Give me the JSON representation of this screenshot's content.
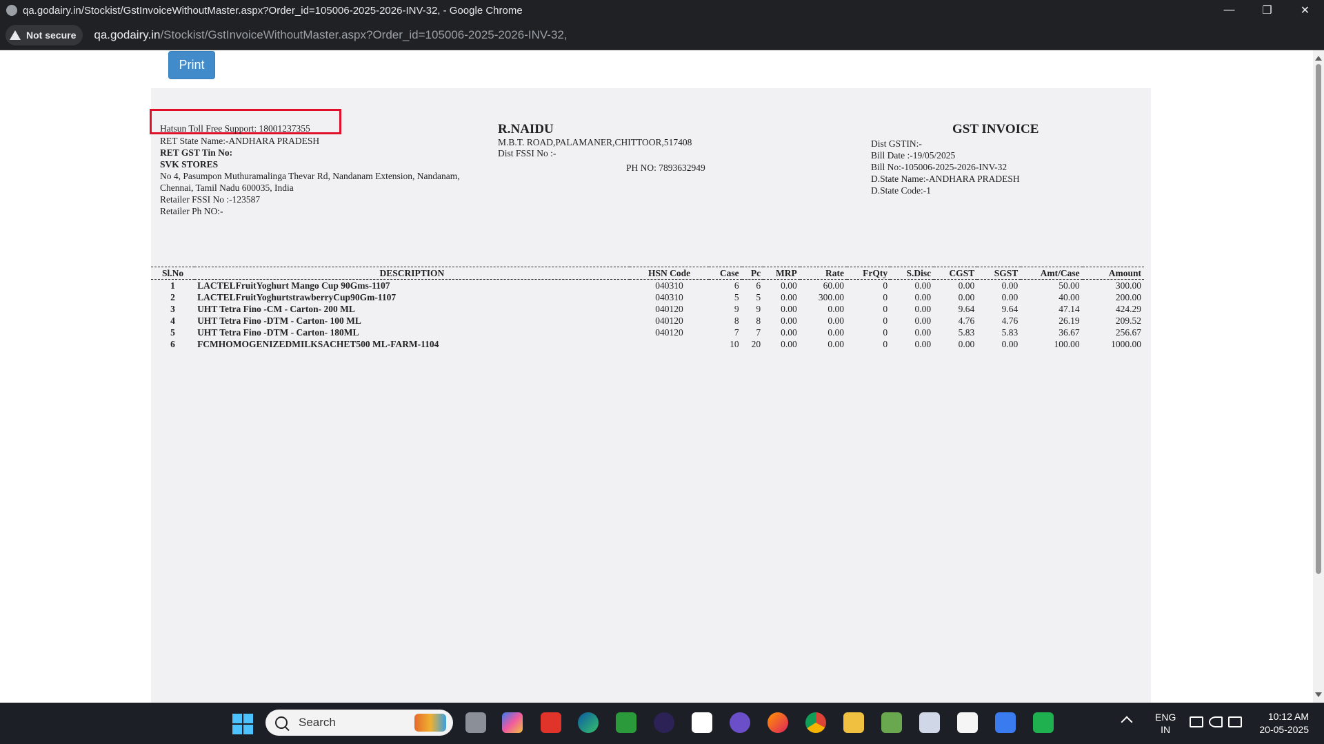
{
  "browser": {
    "window_title": "qa.godairy.in/Stockist/GstInvoiceWithoutMaster.aspx?Order_id=105006-2025-2026-INV-32, - Google Chrome",
    "security_label": "Not secure",
    "url_host": "qa.godairy.in",
    "url_path": "/Stockist/GstInvoiceWithoutMaster.aspx?Order_id=105006-2025-2026-INV-32,"
  },
  "page": {
    "print_label": "Print"
  },
  "invoice": {
    "support": "Hatsun Toll Free Support: 18001237355",
    "ret_state": "RET State Name:-ANDHARA PRADESH",
    "ret_gst": "RET GST Tin No:",
    "retailer_name": "SVK STORES",
    "address_line1": "No 4, Pasumpon Muthuramalinga Thevar Rd, Nandanam Extension, Nandanam,",
    "address_line2": "Chennai, Tamil Nadu 600035, India",
    "retailer_fssi": "Retailer FSSI No :-123587",
    "retailer_ph": "Retailer Ph NO:-",
    "seller_name": "R.NAIDU",
    "seller_address": "M.B.T. ROAD,PALAMANER,CHITTOOR,517408",
    "dist_fssi": "Dist FSSI No :-",
    "ph_no": "PH NO:  7893632949",
    "title": "GST INVOICE",
    "dist_gstin": "Dist GSTIN:-",
    "bill_date": "Bill Date :-19/05/2025",
    "bill_no": "Bill No:-105006-2025-2026-INV-32",
    "d_state_name": "D.State Name:-ANDHARA PRADESH",
    "d_state_code": "D.State Code:-1",
    "columns": [
      "Sl.No",
      "DESCRIPTION",
      "HSN Code",
      "Case",
      "Pc",
      "MRP",
      "Rate",
      "FrQty",
      "S.Disc",
      "CGST",
      "SGST",
      "Amt/Case",
      "Amount"
    ],
    "rows": [
      [
        "1",
        "LACTELFruitYoghurt Mango Cup 90Gms-1107",
        "040310",
        "6",
        "6",
        "0.00",
        "60.00",
        "0",
        "0.00",
        "0.00",
        "0.00",
        "50.00",
        "300.00"
      ],
      [
        "2",
        "LACTELFruitYoghurtstrawberryCup90Gm-1107",
        "040310",
        "5",
        "5",
        "0.00",
        "300.00",
        "0",
        "0.00",
        "0.00",
        "0.00",
        "40.00",
        "200.00"
      ],
      [
        "3",
        "UHT Tetra Fino -CM - Carton- 200 ML",
        "040120",
        "9",
        "9",
        "0.00",
        "0.00",
        "0",
        "0.00",
        "9.64",
        "9.64",
        "47.14",
        "424.29"
      ],
      [
        "4",
        "UHT Tetra Fino -DTM - Carton- 100 ML",
        "040120",
        "8",
        "8",
        "0.00",
        "0.00",
        "0",
        "0.00",
        "4.76",
        "4.76",
        "26.19",
        "209.52"
      ],
      [
        "5",
        "UHT Tetra Fino -DTM - Carton- 180ML",
        "040120",
        "7",
        "7",
        "0.00",
        "0.00",
        "0",
        "0.00",
        "5.83",
        "5.83",
        "36.67",
        "256.67"
      ],
      [
        "6",
        "FCMHOMOGENIZEDMILKSACHET500 ML-FARM-1104",
        "",
        "10",
        "20",
        "0.00",
        "0.00",
        "0",
        "0.00",
        "0.00",
        "0.00",
        "100.00",
        "1000.00"
      ]
    ]
  },
  "taskbar": {
    "search_placeholder": "Search",
    "lang_line1": "ENG",
    "lang_line2": "IN",
    "time": "10:12 AM",
    "date": "20-05-2025"
  },
  "colors": {
    "highlight_box": "#e0102a",
    "print_button": "#428bca",
    "invoice_bg": "#f1f1f3"
  }
}
